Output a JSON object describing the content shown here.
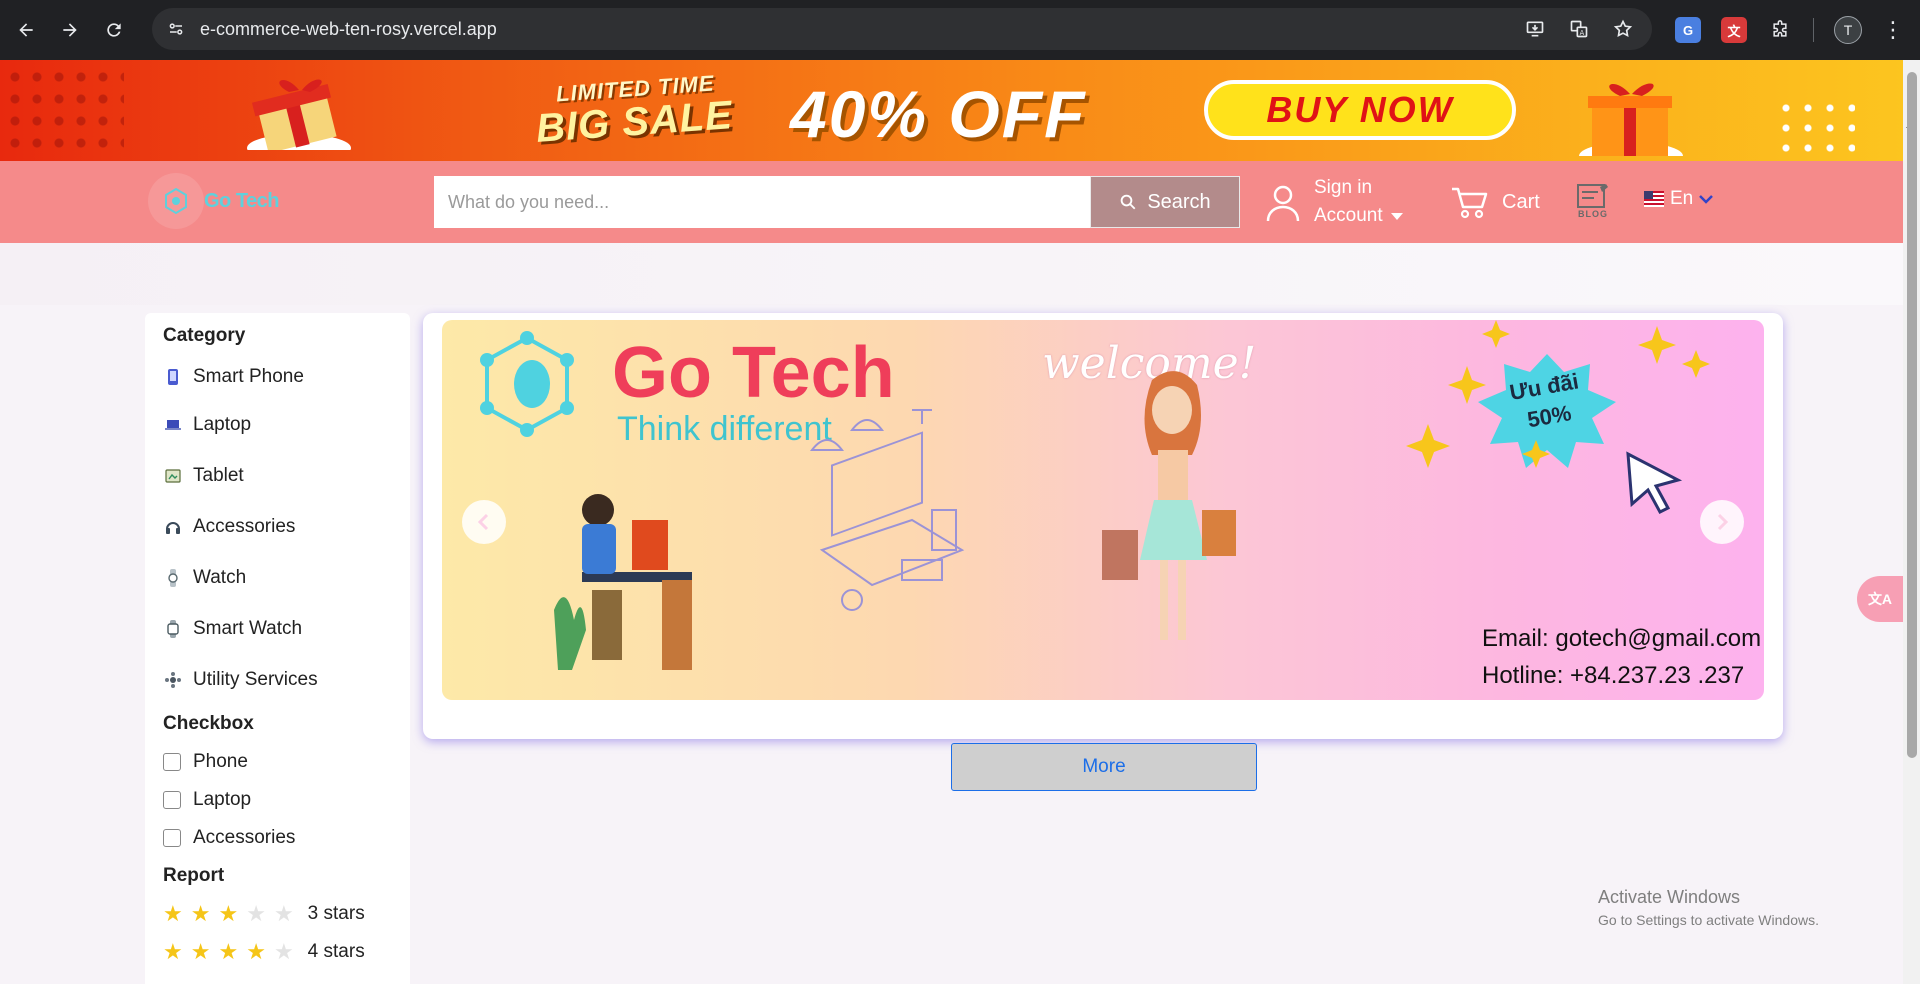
{
  "browser": {
    "url": "e-commerce-web-ten-rosy.vercel.app",
    "profile_initial": "T"
  },
  "promo": {
    "limited": "LIMITED TIME",
    "big_sale": "BIG SALE",
    "discount": "40% OFF",
    "buy_now": "BUY NOW"
  },
  "header": {
    "logo_text": "Go Tech",
    "search_placeholder": "What do you need...",
    "search_label": "Search",
    "sign_in": "Sign in",
    "account": "Account",
    "cart": "Cart",
    "blog_label": "BLOG",
    "language": "En"
  },
  "sidebar": {
    "category_heading": "Category",
    "categories": [
      {
        "label": "Smart Phone",
        "icon": "phone-icon"
      },
      {
        "label": "Laptop",
        "icon": "laptop-icon"
      },
      {
        "label": "Tablet",
        "icon": "tablet-icon"
      },
      {
        "label": "Accessories",
        "icon": "headphones-icon"
      },
      {
        "label": "Watch",
        "icon": "watch-icon"
      },
      {
        "label": "Smart Watch",
        "icon": "smartwatch-icon"
      },
      {
        "label": "Utility Services",
        "icon": "services-icon"
      }
    ],
    "checkbox_heading": "Checkbox",
    "checkboxes": [
      {
        "label": "Phone",
        "checked": false
      },
      {
        "label": "Laptop",
        "checked": false
      },
      {
        "label": "Accessories",
        "checked": false
      }
    ],
    "report_heading": "Report",
    "ratings": [
      {
        "label": "3 stars",
        "value": 3,
        "max": 5
      },
      {
        "label": "4 stars",
        "value": 4,
        "max": 5
      }
    ]
  },
  "slide": {
    "brand_title": "Go Tech",
    "brand_tagline": "Think different",
    "welcome": "welcome!",
    "badge_line1": "Ưu đãi",
    "badge_line2": "50%",
    "email": "Email: gotech@gmail.com",
    "hotline": "Hotline: +84.237.23 .237"
  },
  "main": {
    "more_label": "More"
  },
  "os_watermark": {
    "line1": "Activate Windows",
    "line2": "Go to Settings to activate Windows."
  },
  "colors": {
    "header_bg": "#f58a8a",
    "search_button": "#b38b8b",
    "more_text": "#1c6ee8",
    "star_on": "#f5c518"
  }
}
